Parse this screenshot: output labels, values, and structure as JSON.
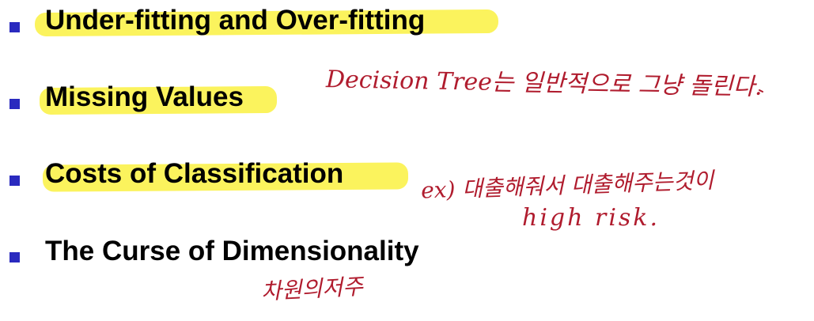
{
  "colors": {
    "bullet": "#2a2abf",
    "highlight": "#fbf24b",
    "ink": "#b01c2e"
  },
  "items": [
    {
      "label": "Under-fitting and Over-fitting",
      "highlighted": true
    },
    {
      "label": "Missing Values",
      "highlighted": true
    },
    {
      "label": "Costs of Classification",
      "highlighted": true
    },
    {
      "label": "The Curse of Dimensionality",
      "highlighted": false
    }
  ],
  "annotations": {
    "missing_values_note": "Decision Tree는 일반적으로 그냥 돌린다.",
    "costs_note_line1": "ex) 대출해줘서 대출해주는것이",
    "costs_note_line2": "high risk.",
    "curse_note": "차원의저주"
  }
}
